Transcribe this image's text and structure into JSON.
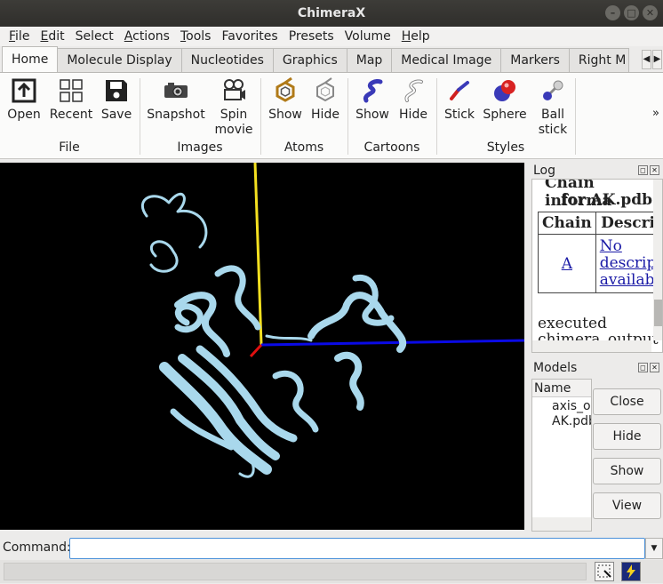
{
  "window": {
    "title": "ChimeraX",
    "controls": [
      "–",
      "□",
      "✕"
    ]
  },
  "menu": [
    {
      "label": "File",
      "mnemonic": "F",
      "rest": "ile"
    },
    {
      "label": "Edit",
      "mnemonic": "E",
      "rest": "dit"
    },
    {
      "label": "Select",
      "mnemonic": "",
      "rest": "Select"
    },
    {
      "label": "Actions",
      "mnemonic": "A",
      "rest": "ctions"
    },
    {
      "label": "Tools",
      "mnemonic": "T",
      "rest": "ools"
    },
    {
      "label": "Favorites",
      "mnemonic": "",
      "rest": "Favorites"
    },
    {
      "label": "Presets",
      "mnemonic": "",
      "rest": "Presets"
    },
    {
      "label": "Volume",
      "mnemonic": "",
      "rest": "Volume"
    },
    {
      "label": "Help",
      "mnemonic": "H",
      "rest": "elp"
    }
  ],
  "tabs": [
    "Home",
    "Molecule Display",
    "Nucleotides",
    "Graphics",
    "Map",
    "Medical Image",
    "Markers",
    "Right M"
  ],
  "tab_scroll": [
    "◀",
    "▶"
  ],
  "toolbar": {
    "file": {
      "group": "File",
      "open": "Open",
      "recent": "Recent",
      "save": "Save"
    },
    "images": {
      "group": "Images",
      "snapshot": "Snapshot",
      "spin_1": "Spin",
      "spin_2": "movie"
    },
    "atoms": {
      "group": "Atoms",
      "show": "Show",
      "hide": "Hide"
    },
    "cartoons": {
      "group": "Cartoons",
      "show": "Show",
      "hide": "Hide"
    },
    "styles": {
      "group": "Styles",
      "stick": "Stick",
      "sphere": "Sphere",
      "ball_1": "Ball",
      "ball_2": "stick"
    },
    "more": "»"
  },
  "log": {
    "title": "Log",
    "heading_1": "Chain informa",
    "heading_2": "for AK.pdb",
    "col_chain": "Chain",
    "col_desc": "Descri",
    "chain_id": "A",
    "desc_1": "No",
    "desc_2": "descrip",
    "desc_3": "availab",
    "executed_1": "executed",
    "executed_2": "chimera_output"
  },
  "models": {
    "title": "Models",
    "header": "Name",
    "items": [
      "axis_ou",
      "AK.pdb"
    ],
    "close": "Close",
    "hide": "Hide",
    "show": "Show",
    "view": "View"
  },
  "command": {
    "label": "Command:",
    "value": ""
  },
  "colors": {
    "ribbon": "#a9d8ec",
    "axis_x": "#0a0ae6",
    "axis_y": "#f4e020",
    "axis_z": "#e01010",
    "background": "#000000"
  }
}
